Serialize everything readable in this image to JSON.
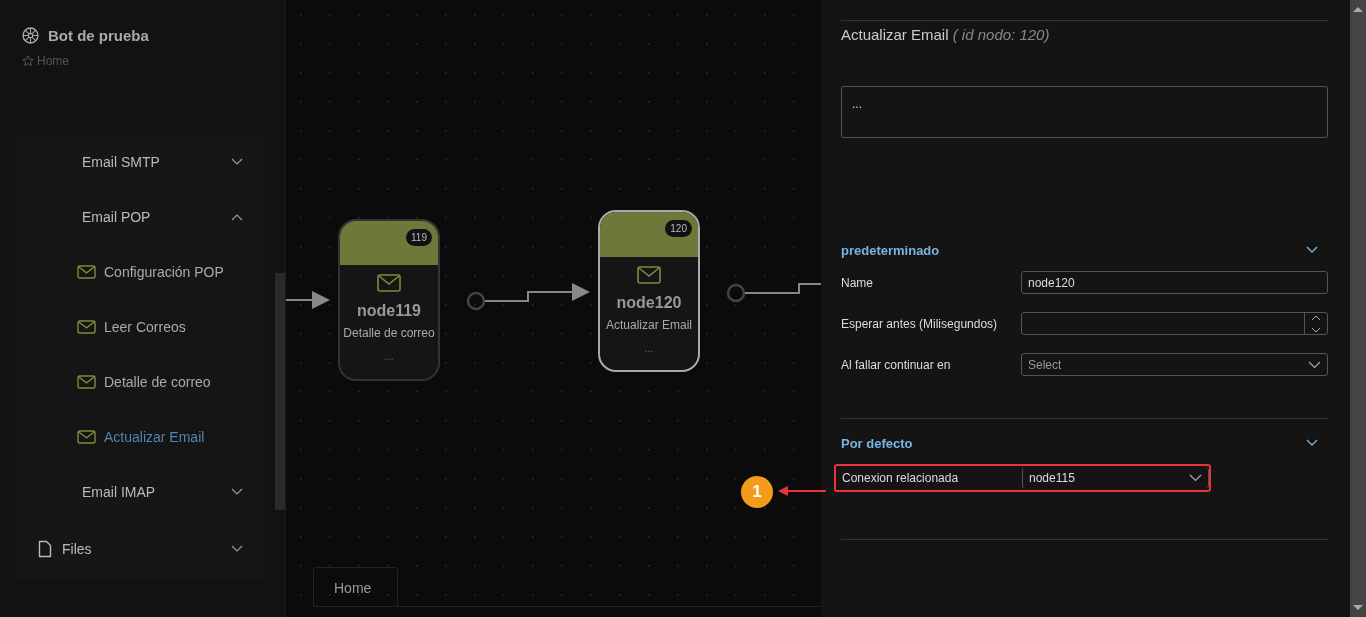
{
  "sidebar": {
    "title": "Bot de prueba",
    "breadcrumb": "Home",
    "items": [
      {
        "label": "Email SMTP",
        "kind": "group",
        "expanded": false
      },
      {
        "label": "Email POP",
        "kind": "group",
        "expanded": true,
        "children": [
          {
            "label": "Configuración POP",
            "selected": false
          },
          {
            "label": "Leer Correos",
            "selected": false
          },
          {
            "label": "Detalle de correo",
            "selected": false
          },
          {
            "label": "Actualizar Email",
            "selected": true
          }
        ]
      },
      {
        "label": "Email IMAP",
        "kind": "group",
        "expanded": false
      },
      {
        "label": "Files",
        "kind": "file",
        "expanded": false
      }
    ]
  },
  "canvas": {
    "nodes": [
      {
        "badge": "119",
        "name": "node119",
        "subtitle": "Detalle de correo",
        "more": "...",
        "selected": false
      },
      {
        "badge": "120",
        "name": "node120",
        "subtitle": "Actualizar Email",
        "more": "...",
        "selected": true
      }
    ],
    "tab": "Home"
  },
  "panel": {
    "title": "Actualizar Email",
    "subtitle": "( id nodo: 120)",
    "description": "...",
    "sections": [
      {
        "title": "predeterminado",
        "fields": [
          {
            "label": "Name",
            "kind": "text",
            "value": "node120"
          },
          {
            "label": "Esperar antes (Milisegundos)",
            "kind": "number"
          },
          {
            "label": "Al fallar continuar en",
            "kind": "select",
            "placeholder": "Select"
          }
        ]
      },
      {
        "title": "Por defecto",
        "fields": [
          {
            "label": "Conexion relacionada",
            "kind": "select",
            "value": "node115",
            "highlighted": true
          }
        ]
      }
    ]
  },
  "callout": {
    "number": "1"
  }
}
